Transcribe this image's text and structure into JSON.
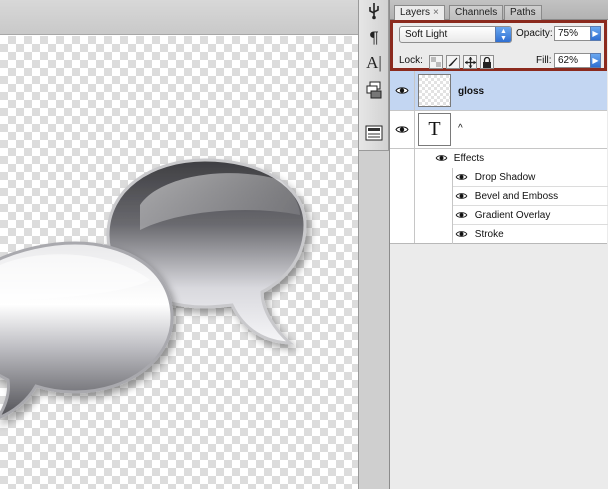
{
  "panel": {
    "tabs": [
      {
        "label": "Layers",
        "close": "×"
      },
      {
        "label": "Channels"
      },
      {
        "label": "Paths"
      }
    ],
    "blend_mode": "Soft Light",
    "opacity_label": "Opacity:",
    "opacity_value": "75%",
    "lock_label": "Lock:",
    "fill_label": "Fill:",
    "fill_value": "62%"
  },
  "layers": [
    {
      "name": "gloss",
      "selected": true,
      "visible": true
    },
    {
      "name": "^",
      "type": "text",
      "thumb_glyph": "T",
      "visible": true
    }
  ],
  "effects": {
    "group_label": "Effects",
    "items": [
      "Drop Shadow",
      "Bevel and Emboss",
      "Gradient Overlay",
      "Stroke"
    ]
  },
  "colors": {
    "selection_highlight": "#c3d6f2",
    "highlight_border": "#8b2a1e",
    "accent_blue": "#2f6fd2"
  },
  "tools": [
    {
      "icon": "usb-icon"
    },
    {
      "icon": "paragraph-icon",
      "glyph": "¶"
    },
    {
      "icon": "character-icon",
      "glyph": "A|"
    },
    {
      "icon": "layer-comps-icon"
    },
    {
      "icon": "navigator-icon"
    }
  ]
}
